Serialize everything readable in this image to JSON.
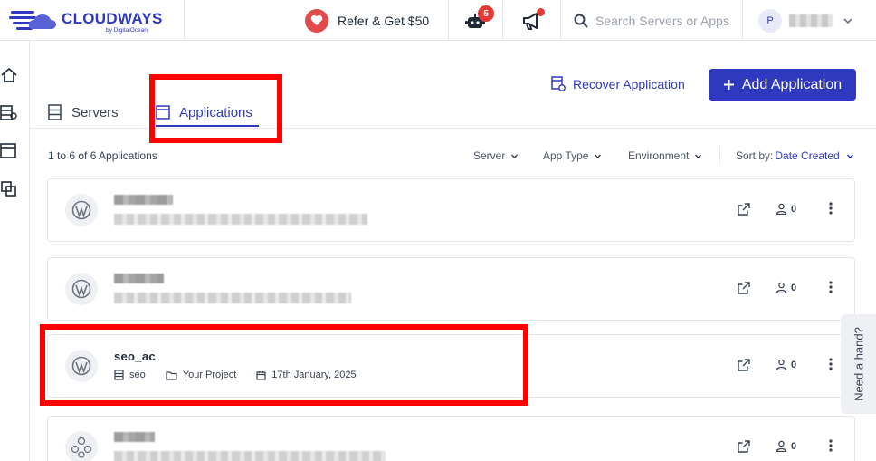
{
  "brand": {
    "name": "CLOUDWAYS",
    "sub": "by DigitalOcean",
    "color": "#2f39bf"
  },
  "topbar": {
    "refer_label": "Refer & Get $50",
    "notifications_count": "5",
    "search_placeholder": "Search Servers or Apps",
    "avatar_initial": "P"
  },
  "sidebar": {
    "items": [
      "home-icon",
      "servers-icon",
      "applications-icon",
      "projects-icon"
    ]
  },
  "header": {
    "recover_label": "Recover Application",
    "add_label": "Add Application",
    "tabs": [
      {
        "label": "Servers",
        "active": false
      },
      {
        "label": "Applications",
        "active": true
      }
    ]
  },
  "filters": {
    "count_text": "1 to 6 of 6 Applications",
    "server": "Server",
    "app_type": "App Type",
    "environment": "Environment",
    "sort_label": "Sort by:",
    "sort_value": "Date Created"
  },
  "apps": [
    {
      "name": "",
      "server": "",
      "project": "",
      "date": "",
      "collaborators": "0",
      "redacted": true
    },
    {
      "name": "",
      "server": "",
      "project": "",
      "date": "",
      "collaborators": "0",
      "redacted": true
    },
    {
      "name": "seo_ac",
      "server": "seo",
      "project": "Your Project",
      "date": "17th January, 2025",
      "collaborators": "0",
      "redacted": false
    },
    {
      "name": "",
      "server": "",
      "project": "",
      "date": "",
      "collaborators": "0",
      "redacted": true
    }
  ],
  "help": {
    "label": "Need a hand?"
  }
}
